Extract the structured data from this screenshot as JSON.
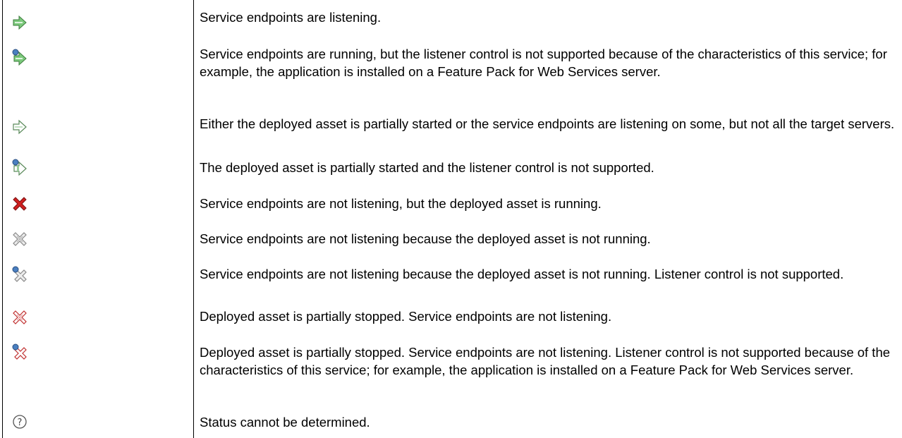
{
  "legend": {
    "rows": [
      {
        "icon": "started-icon",
        "text": "Service endpoints are listening."
      },
      {
        "icon": "started-unsupported-icon",
        "text": "Service endpoints are running, but the listener control is not supported because of the characteristics of this service; for example, the application is installed on a Feature Pack for Web Services server."
      },
      {
        "icon": "partial-started-icon",
        "text": "Either the deployed asset is partially started or the service endpoints are listening on some, but not all the target servers."
      },
      {
        "icon": "partial-started-unsupported-icon",
        "text": "The deployed asset is partially started and the listener control is not supported."
      },
      {
        "icon": "stopped-red-icon",
        "text": "Service endpoints are not listening, but the deployed asset is running."
      },
      {
        "icon": "stopped-grey-icon",
        "text": "Service endpoints are not listening because the deployed asset is not running."
      },
      {
        "icon": "stopped-grey-unsupported-icon",
        "text": "Service endpoints are not listening because the deployed asset is not running. Listener control is not supported."
      },
      {
        "icon": "partial-stopped-icon",
        "text": "Deployed asset is partially stopped. Service endpoints are not listening."
      },
      {
        "icon": "partial-stopped-unsupported-icon",
        "text": "Deployed asset is partially stopped. Service endpoints are not listening. Listener control is not supported because of the characteristics of this service; for example, the application is installed on a Feature Pack for Web Services server."
      },
      {
        "icon": "unknown-status-icon",
        "text": "Status cannot be determined."
      }
    ]
  },
  "colors": {
    "arrow_green": "#6fbf6f",
    "arrow_blue": "#4a7fc0",
    "x_red": "#d02020",
    "x_grey": "#9a9a9a",
    "border": "#000000"
  }
}
